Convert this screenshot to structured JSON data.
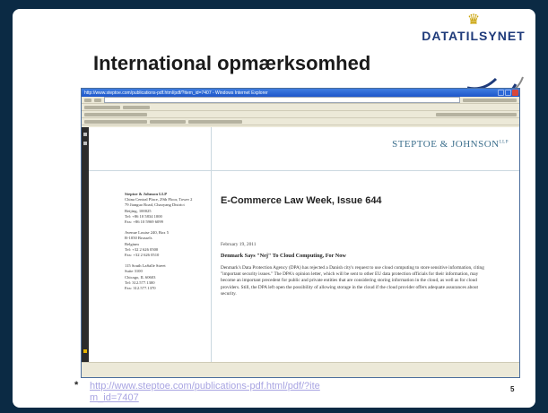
{
  "slide": {
    "title": "International opmærksomhed",
    "logo_text": "DATATILSYNET",
    "footnote_marker": "*",
    "footnote_link": "http://www.steptoe.com/publications-pdf.html/pdf/?item_id=7407",
    "page_number": "5"
  },
  "browser": {
    "window_title": "http://www.steptoe.com/publications-pdf.html/pdf/?item_id=7407 - Windows Internet Explorer"
  },
  "document": {
    "firm_header": "STEPTOE & JOHNSON",
    "firm_header_suffix": "LLP",
    "firm_name": "Steptoe & Johnson LLP",
    "addresses": [
      [
        "China Central Place, 29th Floor, Tower 2",
        "79 Jianguo Road, Chaoyang District",
        "Beijing, 100025",
        "Tel: +86 10 5834 1000",
        "Fax: +86 10 5969 6099"
      ],
      [
        "Avenue Louise 240, Box 5",
        "B-1050 Brussels",
        "Belgium",
        "Tel: +32 2 626 0500",
        "Fax: +32 2 626 0510"
      ],
      [
        "115 South LaSalle Street",
        "Suite 3100",
        "Chicago, IL 60603",
        "Tel: 312.577.1300",
        "Fax: 312.577.1370"
      ]
    ],
    "publication_title": "E-Commerce Law Week, Issue 644",
    "date": "February 19, 2011",
    "headline": "Denmark Says \"Nej\" To Cloud Computing, For Now",
    "body": "Denmark's Data Protection Agency (DPA) has rejected a Danish city's request to use cloud computing to store sensitive information, citing \"important security issues.\" The DPA's opinion letter, which will be sent to other EU data protection officials for their information, may become an important precedent for public and private entities that are considering storing information in the cloud, as well as for cloud providers. Still, the DPA left open the possibility of allowing storage in the cloud if the cloud provider offers adequate assurances about security."
  },
  "colors": {
    "frame": "#0b2a44",
    "logo": "#1e3a7a",
    "header_text": "#3b6e8c",
    "link": "#a8a4e2"
  }
}
